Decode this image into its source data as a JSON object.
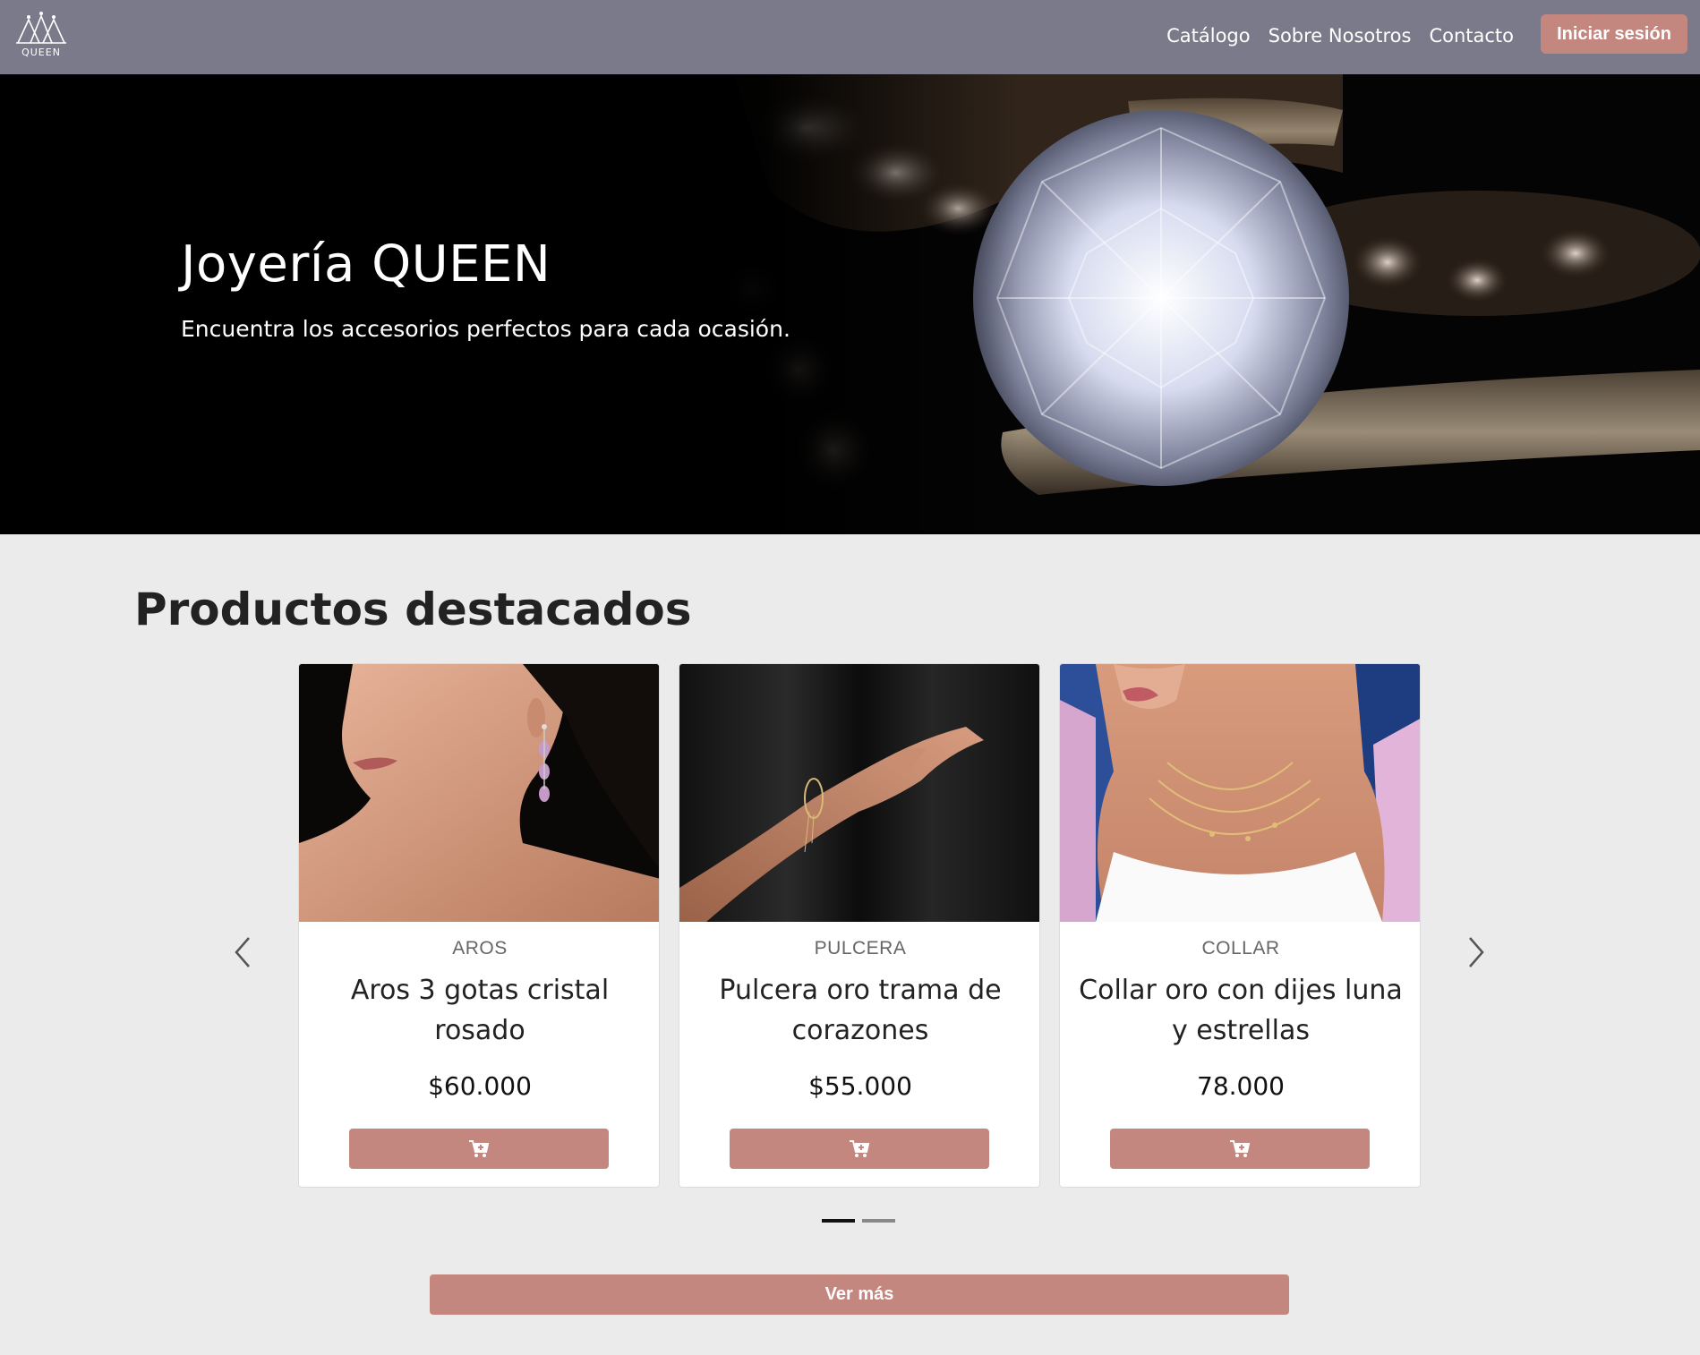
{
  "navbar": {
    "logo_text": "QUEEN",
    "links": [
      "Catálogo",
      "Sobre Nosotros",
      "Contacto"
    ],
    "login_label": "Iniciar sesión",
    "background": "#7b7a8a"
  },
  "hero": {
    "title": "Joyería QUEEN",
    "subtitle": "Encuentra los accesorios perfectos para cada ocasión."
  },
  "featured": {
    "title": "Productos destacados",
    "products": [
      {
        "category": "AROS",
        "name": "Aros 3 gotas cristal rosado",
        "price": "$60.000",
        "cart_icon": "cart-plus-icon"
      },
      {
        "category": "PULCERA",
        "name": "Pulcera oro trama de corazones",
        "price": "$55.000",
        "cart_icon": "cart-plus-icon"
      },
      {
        "category": "COLLAR",
        "name": "Collar oro con dijes luna y estrellas",
        "price": "78.000",
        "cart_icon": "cart-plus-icon"
      }
    ],
    "active_slide": 1,
    "slide_count": 2,
    "see_more_label": "Ver más"
  },
  "colors": {
    "accent": "#c4877f",
    "page_background": "#ebebeb"
  }
}
